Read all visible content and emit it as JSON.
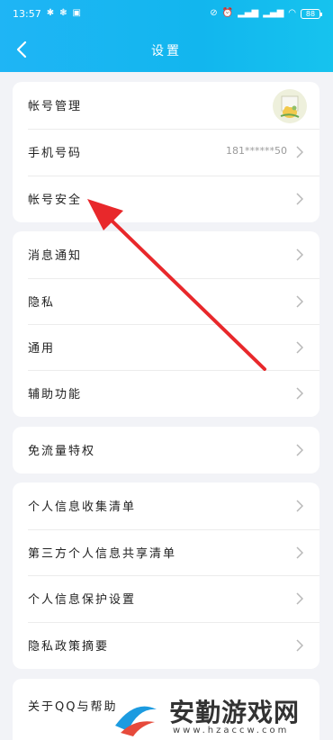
{
  "status_bar": {
    "time": "13:57",
    "battery": "88"
  },
  "header": {
    "title": "设置"
  },
  "groups": [
    {
      "rows": [
        {
          "label": "帐号管理"
        },
        {
          "label": "手机号码",
          "value": "181******50"
        },
        {
          "label": "帐号安全"
        }
      ]
    },
    {
      "rows": [
        {
          "label": "消息通知"
        },
        {
          "label": "隐私"
        },
        {
          "label": "通用"
        },
        {
          "label": "辅助功能"
        }
      ]
    },
    {
      "rows": [
        {
          "label": "免流量特权"
        }
      ]
    },
    {
      "rows": [
        {
          "label": "个人信息收集清单"
        },
        {
          "label": "第三方个人信息共享清单"
        },
        {
          "label": "个人信息保护设置"
        },
        {
          "label": "隐私政策摘要"
        }
      ]
    },
    {
      "rows": [
        {
          "label": "关于QQ与帮助"
        }
      ]
    }
  ],
  "watermark": {
    "brand": "安勤游戏网",
    "url": "www.hzaccw.com"
  },
  "colors": {
    "header": "#12b6ee",
    "arrow": "#e8282b",
    "background": "#f2f3f7"
  }
}
